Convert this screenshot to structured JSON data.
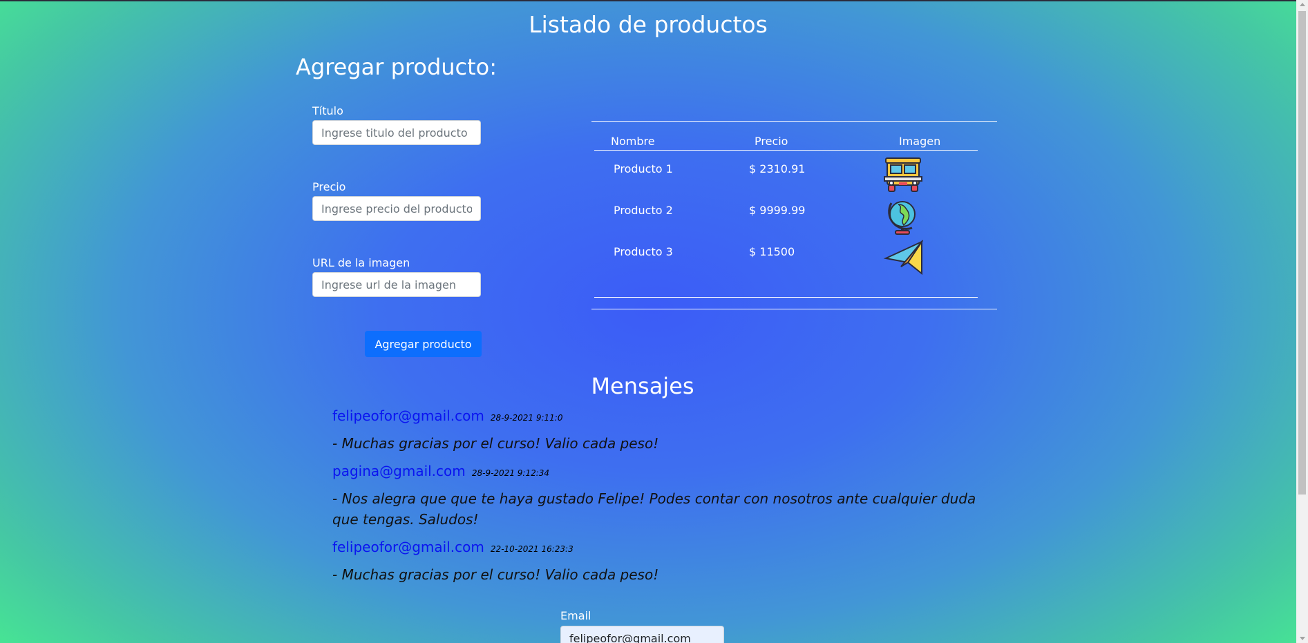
{
  "header": {
    "title": "Listado de productos"
  },
  "add_form": {
    "title": "Agregar producto:",
    "fields": [
      {
        "label": "Título",
        "placeholder": "Ingrese titulo del producto",
        "value": ""
      },
      {
        "label": "Precio",
        "placeholder": "Ingrese precio del producto",
        "value": ""
      },
      {
        "label": "URL de la imagen",
        "placeholder": "Ingrese url de la imagen",
        "value": ""
      }
    ],
    "submit_label": "Agregar producto",
    "button_color": "#0d6efd"
  },
  "products_table": {
    "columns": [
      "Nombre",
      "Precio",
      "Imagen"
    ],
    "rows": [
      {
        "name": "Producto 1",
        "price": "$ 2310.91",
        "image_icon": "bus-icon"
      },
      {
        "name": "Producto 2",
        "price": "$ 9999.99",
        "image_icon": "globe-icon"
      },
      {
        "name": "Producto 3",
        "price": "$ 11500",
        "image_icon": "paper-plane-icon"
      }
    ]
  },
  "messages": {
    "title": "Mensajes",
    "author_color": "#0a14f0",
    "items": [
      {
        "author": "felipeofor@gmail.com",
        "date": "28-9-2021 9:11:0",
        "text": "- Muchas gracias por el curso! Valio cada peso!"
      },
      {
        "author": "pagina@gmail.com",
        "date": "28-9-2021 9:12:34",
        "text": "- Nos alegra que que te haya gustado Felipe! Podes contar con nosotros ante cualquier duda que tengas. Saludos!"
      },
      {
        "author": "felipeofor@gmail.com",
        "date": "22-10-2021 16:23:3",
        "text": "- Muchas gracias por el curso! Valio cada peso!"
      }
    ]
  },
  "chat_form": {
    "email_label": "Email",
    "email_value": "felipeofor@gmail.com"
  },
  "theme": {
    "background_center": "#3c5cf7",
    "background_edge": "#48f28c"
  }
}
